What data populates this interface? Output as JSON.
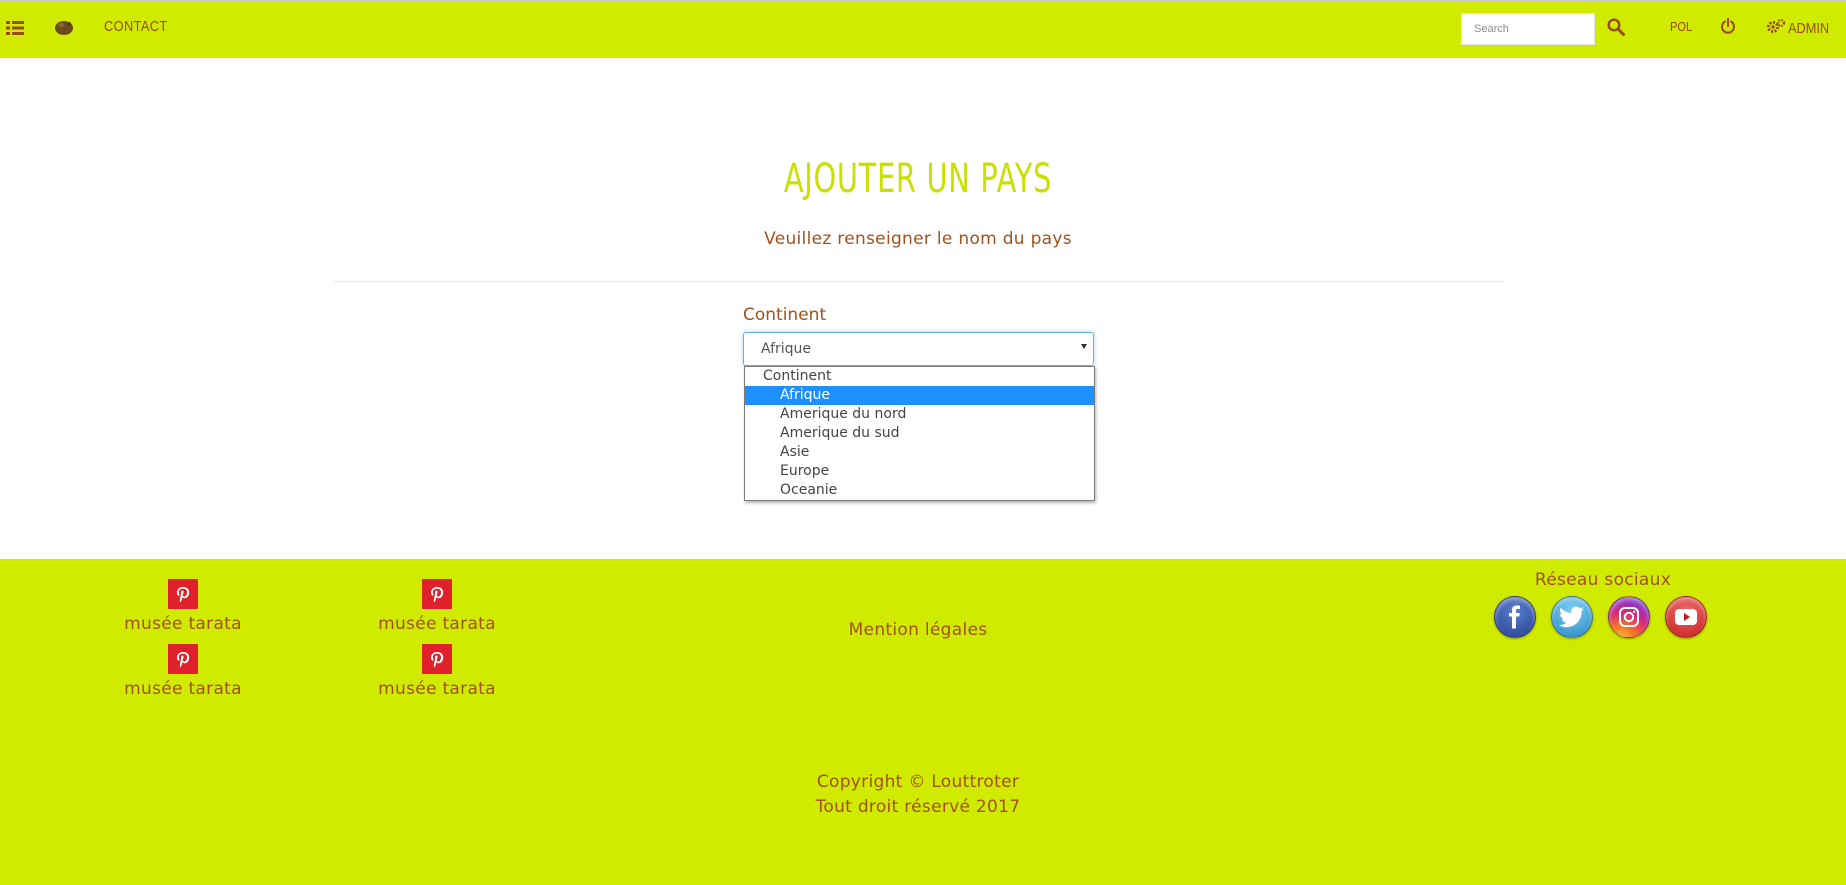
{
  "nav": {
    "contact_label": "CONTACT",
    "search_placeholder": "Search",
    "language_label": "POL",
    "admin_label": "ADMIN",
    "icons": [
      "list-icon",
      "logo-icon",
      "search-icon",
      "power-icon",
      "gears-icon"
    ]
  },
  "main": {
    "title": "Ajouter un pays",
    "subtitle": "Veuillez renseigner le nom du pays",
    "field_label": "Continent",
    "selected_value": "Afrique",
    "dropdown": {
      "group_label": "Continent",
      "options": [
        "Afrique",
        "Amerique du nord",
        "Amerique du sud",
        "Asie",
        "Europe",
        "Oceanie"
      ],
      "highlighted": "Afrique"
    }
  },
  "footer": {
    "links": [
      "musée tarata",
      "musée tarata",
      "musée tarata",
      "musée tarata"
    ],
    "mention": "Mention légales",
    "social_title": "Réseau sociaux",
    "social_icons": [
      "facebook-icon",
      "twitter-icon",
      "instagram-icon",
      "youtube-icon"
    ],
    "copyright_line1": "Copyright © Louttroter",
    "copyright_line2": "Tout droit réservé 2017"
  },
  "colors": {
    "brand_lime": "#d0ea00",
    "text_brown": "#a0521e",
    "title_lime": "#c9e000",
    "option_highlight": "#1e90ff",
    "pinterest_red": "#e0202a"
  }
}
